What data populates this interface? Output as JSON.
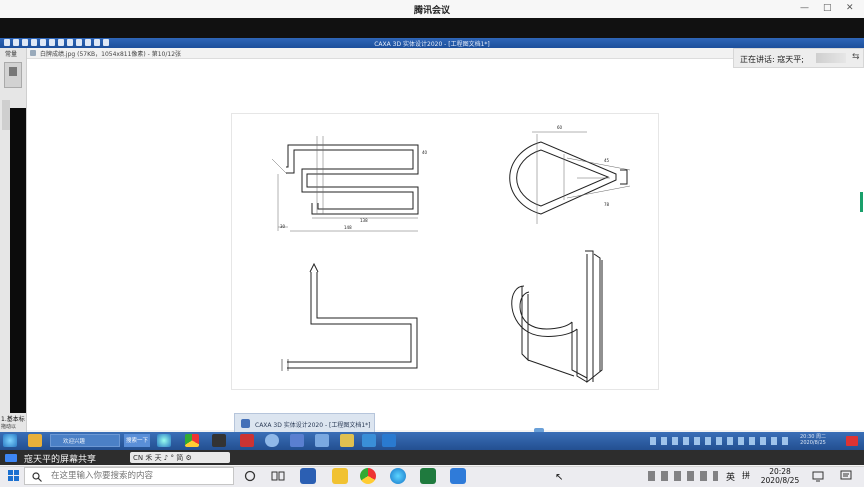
{
  "meeting": {
    "title": "腾讯会议"
  },
  "remote_app": {
    "title": "CAXA 3D 实体设计2020 - [工程图文档1*]",
    "viewer_file": "白牌成绩.jpg (57KB，1054x811像素) - 第10/12张",
    "speaker_label": "正在讲话: 寇天平;",
    "thumbnail_title": "CAXA 3D 实体设计2020 - [工程图文档1*]",
    "taskbar_tab": "欢迎兴趣",
    "taskbar_search": "搜索一下",
    "left_panel_label": "常量",
    "left_panel_bottom": "1.基本标",
    "left_panel_bottom2": "拖动以",
    "time": "20:30 周二",
    "date": "2020/8/25"
  },
  "drawing": {
    "dims": [
      "148",
      "138",
      "30",
      "40",
      "60",
      "45",
      "78"
    ]
  },
  "share_banner": {
    "label": "寇天平的屏幕共享",
    "ime": "CN 禾 天 ♪ ° 简 ⚙"
  },
  "taskbar": {
    "search_placeholder": "在这里输入你要搜索的内容",
    "ime_mode": "英",
    "ime_grid": "拼",
    "time": "20:28",
    "date": "2020/8/25"
  },
  "colors": {
    "remote_titlebar": "#2f66b8",
    "remote_taskbar": "#234f91",
    "share_banner": "#2d2d2d",
    "local_taskbar": "#ececf0"
  }
}
